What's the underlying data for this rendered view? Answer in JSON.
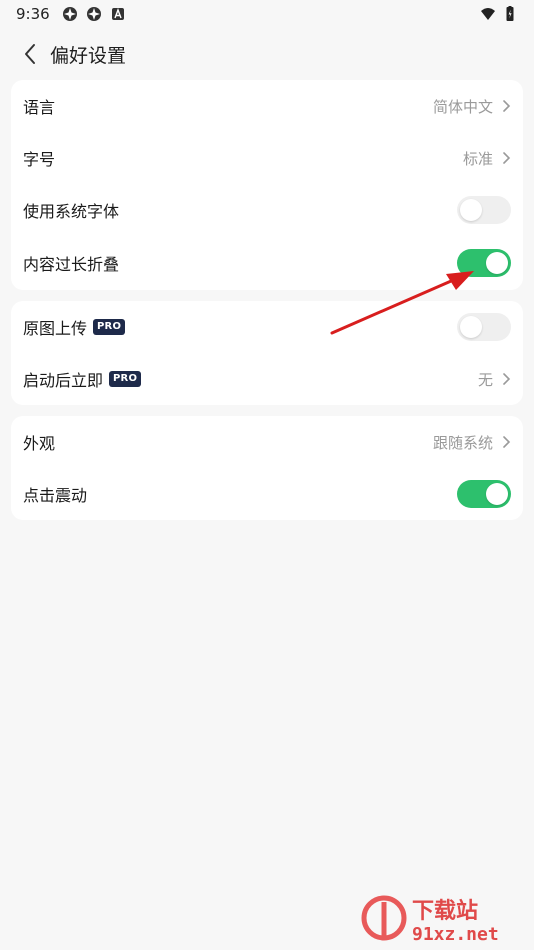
{
  "status_bar": {
    "time": "9:36"
  },
  "header": {
    "title": "偏好设置"
  },
  "sections": [
    {
      "rows": [
        {
          "label": "语言",
          "value": "简体中文",
          "kind": "nav"
        },
        {
          "label": "字号",
          "value": "标准",
          "kind": "nav"
        },
        {
          "label": "使用系统字体",
          "kind": "toggle",
          "on": false
        },
        {
          "label": "内容过长折叠",
          "kind": "toggle",
          "on": true
        }
      ]
    },
    {
      "rows": [
        {
          "label": "原图上传",
          "badge": "PRO",
          "kind": "toggle",
          "on": false
        },
        {
          "label": "启动后立即",
          "badge": "PRO",
          "value": "无",
          "kind": "nav"
        }
      ]
    },
    {
      "rows": [
        {
          "label": "外观",
          "value": "跟随系统",
          "kind": "nav"
        },
        {
          "label": "点击震动",
          "kind": "toggle",
          "on": true
        }
      ]
    }
  ],
  "colors": {
    "toggle_on": "#2dc06d",
    "toggle_off": "#efefef",
    "badge_bg": "#1e2a4a",
    "annotation_arrow": "#d81e1e"
  },
  "watermark": {
    "brand": "下载站",
    "domain": "91xz.net"
  }
}
